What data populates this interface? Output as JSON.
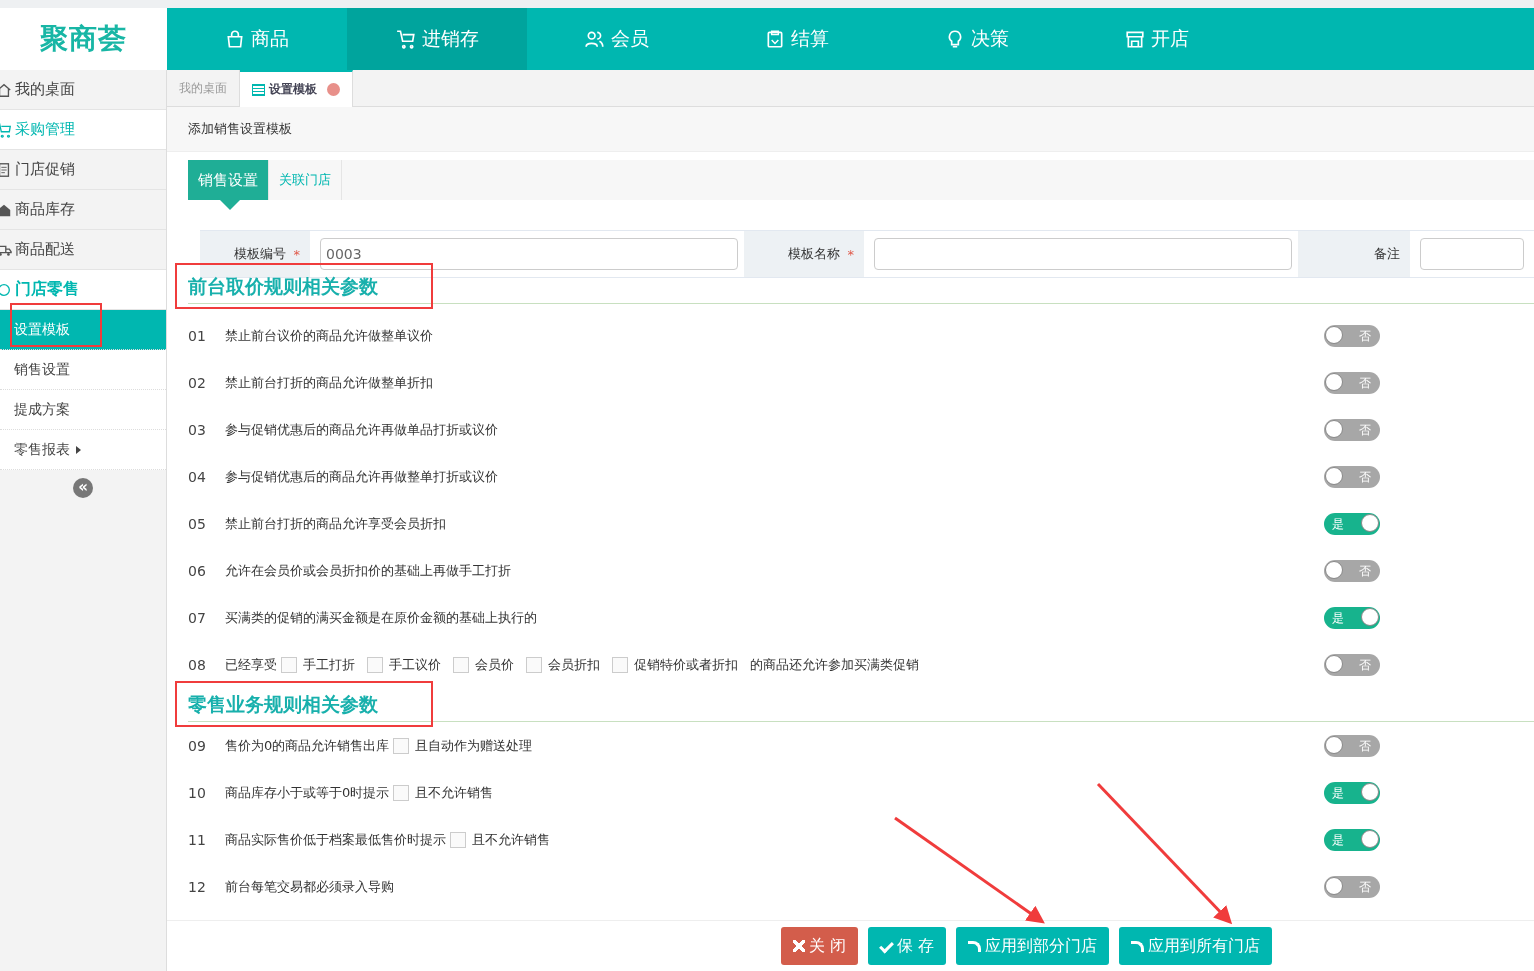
{
  "logo": {
    "text": "聚商荟"
  },
  "nav": [
    {
      "label": "商品",
      "selected": false
    },
    {
      "label": "进销存",
      "selected": true
    },
    {
      "label": "会员",
      "selected": false
    },
    {
      "label": "结算",
      "selected": false
    },
    {
      "label": "决策",
      "selected": false
    },
    {
      "label": "开店",
      "selected": false
    }
  ],
  "sidebar": {
    "items": [
      {
        "label": "我的桌面",
        "kind": "item",
        "selected": false
      },
      {
        "label": "采购管理",
        "kind": "item",
        "selected": true
      },
      {
        "label": "门店促销",
        "kind": "item",
        "selected": false
      },
      {
        "label": "商品库存",
        "kind": "item",
        "selected": false
      },
      {
        "label": "商品配送",
        "kind": "item",
        "selected": false
      },
      {
        "label": "门店零售",
        "kind": "group",
        "selected": true
      },
      {
        "label": "设置模板",
        "kind": "sub",
        "selected": true
      },
      {
        "label": "销售设置",
        "kind": "sub",
        "selected": false
      },
      {
        "label": "提成方案",
        "kind": "sub",
        "selected": false
      },
      {
        "label": "零售报表",
        "kind": "sub",
        "selected": false,
        "submenu": true
      }
    ]
  },
  "tabs": [
    {
      "label": "我的桌面",
      "selected": false,
      "closable": false
    },
    {
      "label": "设置模板",
      "selected": true,
      "closable": true
    }
  ],
  "page_title": "添加销售设置模板",
  "subtabs": [
    {
      "label": "销售设置",
      "selected": true
    },
    {
      "label": "关联门店",
      "selected": false
    }
  ],
  "collapse_glyph": "«",
  "form": [
    {
      "label": "模板编号",
      "required_mark": "*",
      "value": "0003"
    },
    {
      "label": "模板名称",
      "required_mark": "*"
    },
    {
      "label": "备注"
    }
  ],
  "sections": [
    {
      "title": "前台取价规则相关参数",
      "highlighted": true,
      "rows": [
        {
          "number": "01",
          "parts": [
            {
              "kind": "text",
              "text": "禁止前台议价的商品允许做整单议价"
            }
          ],
          "on": false,
          "toggle_label": "否"
        },
        {
          "number": "02",
          "parts": [
            {
              "kind": "text",
              "text": "禁止前台打折的商品允许做整单折扣"
            }
          ],
          "on": false,
          "toggle_label": "否"
        },
        {
          "number": "03",
          "parts": [
            {
              "kind": "text",
              "text": "参与促销优惠后的商品允许再做单品打折或议价"
            }
          ],
          "on": false,
          "toggle_label": "否"
        },
        {
          "number": "04",
          "parts": [
            {
              "kind": "text",
              "text": "参与促销优惠后的商品允许再做整单打折或议价"
            }
          ],
          "on": false,
          "toggle_label": "否"
        },
        {
          "number": "05",
          "parts": [
            {
              "kind": "text",
              "text": "禁止前台打折的商品允许享受会员折扣"
            }
          ],
          "on": true,
          "toggle_label": "是"
        },
        {
          "number": "06",
          "parts": [
            {
              "kind": "text",
              "text": "允许在会员价或会员折扣价的基础上再做手工打折"
            }
          ],
          "on": false,
          "toggle_label": "否"
        },
        {
          "number": "07",
          "parts": [
            {
              "kind": "text",
              "text": "买满类的促销的满买金额是在原价金额的基础上执行的"
            }
          ],
          "on": true,
          "toggle_label": "是"
        },
        {
          "number": "08",
          "parts": [
            {
              "kind": "text",
              "text": "已经享受"
            },
            {
              "kind": "check",
              "checked": false,
              "label": "手工打折"
            },
            {
              "kind": "check",
              "checked": false,
              "label": "手工议价"
            },
            {
              "kind": "check",
              "checked": false,
              "label": "会员价"
            },
            {
              "kind": "check",
              "checked": false,
              "label": "会员折扣"
            },
            {
              "kind": "check",
              "checked": false,
              "label": "促销特价或者折扣"
            },
            {
              "kind": "text",
              "text": "的商品还允许参加买满类促销"
            }
          ],
          "on": false,
          "toggle_label": "否"
        }
      ]
    },
    {
      "title": "零售业务规则相关参数",
      "highlighted": true,
      "rows": [
        {
          "number": "09",
          "parts": [
            {
              "kind": "text",
              "text": "售价为0的商品允许销售出库"
            },
            {
              "kind": "check",
              "checked": false,
              "label": "且自动作为赠送处理"
            }
          ],
          "on": false,
          "toggle_label": "否"
        },
        {
          "number": "10",
          "parts": [
            {
              "kind": "text",
              "text": "商品库存小于或等于0时提示"
            },
            {
              "kind": "check",
              "checked": false,
              "label": "且不允许销售"
            }
          ],
          "on": true,
          "toggle_label": "是"
        },
        {
          "number": "11",
          "parts": [
            {
              "kind": "text",
              "text": "商品实际售价低于档案最低售价时提示"
            },
            {
              "kind": "check",
              "checked": false,
              "label": "且不允许销售"
            }
          ],
          "on": true,
          "toggle_label": "是"
        },
        {
          "number": "12",
          "parts": [
            {
              "kind": "text",
              "text": "前台每笔交易都必须录入导购"
            }
          ],
          "on": false,
          "toggle_label": "否"
        }
      ]
    }
  ],
  "buttons": [
    {
      "label": "关 闭",
      "kind": "close"
    },
    {
      "label": "保 存",
      "kind": "save"
    },
    {
      "label": "应用到部分门店",
      "kind": "apply"
    },
    {
      "label": "应用到所有门店",
      "kind": "apply"
    }
  ]
}
